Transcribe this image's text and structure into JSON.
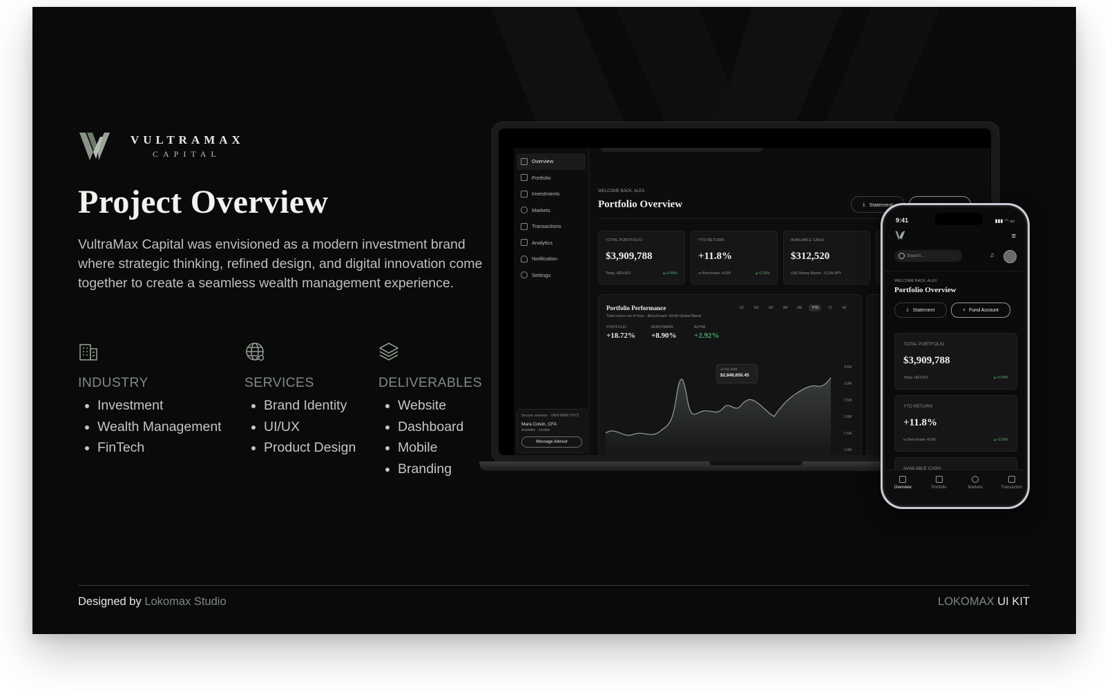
{
  "brand": {
    "name": "VULTRAMAX",
    "sub": "CAPITAL"
  },
  "title": "Project Overview",
  "description": "VultraMax Capital was envisioned as a modern investment brand where strategic thinking, refined design, and digital innovation come together to create a seamless wealth management experience.",
  "columns": [
    {
      "icon": "building-icon",
      "heading": "INDUSTRY",
      "items": [
        "Investment",
        "Wealth Management",
        "FinTech"
      ]
    },
    {
      "icon": "globe-icon",
      "heading": "SERVICES",
      "items": [
        "Brand Identity",
        "UI/UX",
        "Product Design"
      ]
    },
    {
      "icon": "layers-icon",
      "heading": "DELIVERABLES",
      "items": [
        "Website",
        "Dashboard",
        "Mobile",
        "Branding"
      ]
    }
  ],
  "footer": {
    "designed_by": "Designed by",
    "studio": "Lokomax Studio",
    "kit_brand": "LOKOMAX",
    "kit_label": "UI KIT"
  },
  "colors": {
    "accent": "#7d8a7c",
    "background": "#0a0a0b",
    "positive": "#4fa869"
  },
  "dashboard": {
    "nav": [
      "Overview",
      "Portfolio",
      "Investments",
      "Markets",
      "Transactions",
      "Analytics",
      "Notification",
      "Settings"
    ],
    "welcome": "WELCOME BACK, ALEX",
    "title": "Portfolio Overview",
    "statement_btn": "Statement",
    "fund_btn": "Fund Account",
    "cards": [
      {
        "label": "TOTAL PORTFOLIO",
        "value": "$3,909,788",
        "sub": "Today +$24,810",
        "change": "▲+0.64%"
      },
      {
        "label": "YTD RETURN",
        "value": "+11.8%",
        "sub": "vs Benchmark +8.8%",
        "change": "▲+2.92%"
      },
      {
        "label": "AVAILABLE CASH",
        "value": "$312,520",
        "sub": "USD Money Market · 5.10% APY",
        "change": ""
      }
    ],
    "performance": {
      "title": "Portfolio Performance",
      "subtitle": "Total return net of fees · Benchmark: 60/40 Global Blend",
      "metrics": [
        {
          "label": "PORTFOLIO",
          "value": "+18.72%"
        },
        {
          "label": "BENCHMARK",
          "value": "+8.90%"
        },
        {
          "label": "ALPHA",
          "value": "+2.92%"
        }
      ],
      "ranges": [
        "1D",
        "1W",
        "1M",
        "3M",
        "6M",
        "YTD",
        "1Y",
        "All"
      ],
      "tooltip_date": "Jul 03, 2026",
      "tooltip_value": "$2,846,650.45",
      "y_labels": [
        "3.5M",
        "3.0M",
        "2.5M",
        "2.0M",
        "1.5M",
        "1.0M"
      ]
    },
    "advisor": {
      "session": "Secure session · VMX-8842-T573",
      "name": "Mara Colvin, CFA",
      "status": "Available · London",
      "button": "Message Advisor"
    }
  },
  "mobile": {
    "time": "9:41",
    "search_placeholder": "Search...",
    "welcome": "WELCOME BACK, ALEX",
    "title": "Portfolio Overview",
    "statement_btn": "Statement",
    "fund_btn": "Fund Account",
    "cards": [
      {
        "label": "TOTAL PORTFOLIO",
        "value": "$3,909,788",
        "sub": "Today +$24,810",
        "change": "▲+0.64%"
      },
      {
        "label": "YTD RETURN",
        "value": "+11.8%",
        "sub": "vs Benchmark +8.8%",
        "change": "▲+2.92%"
      },
      {
        "label": "AVAILABLE CASH"
      }
    ],
    "tabs": [
      "Overview",
      "Portfolio",
      "Markets",
      "Transaction"
    ]
  }
}
